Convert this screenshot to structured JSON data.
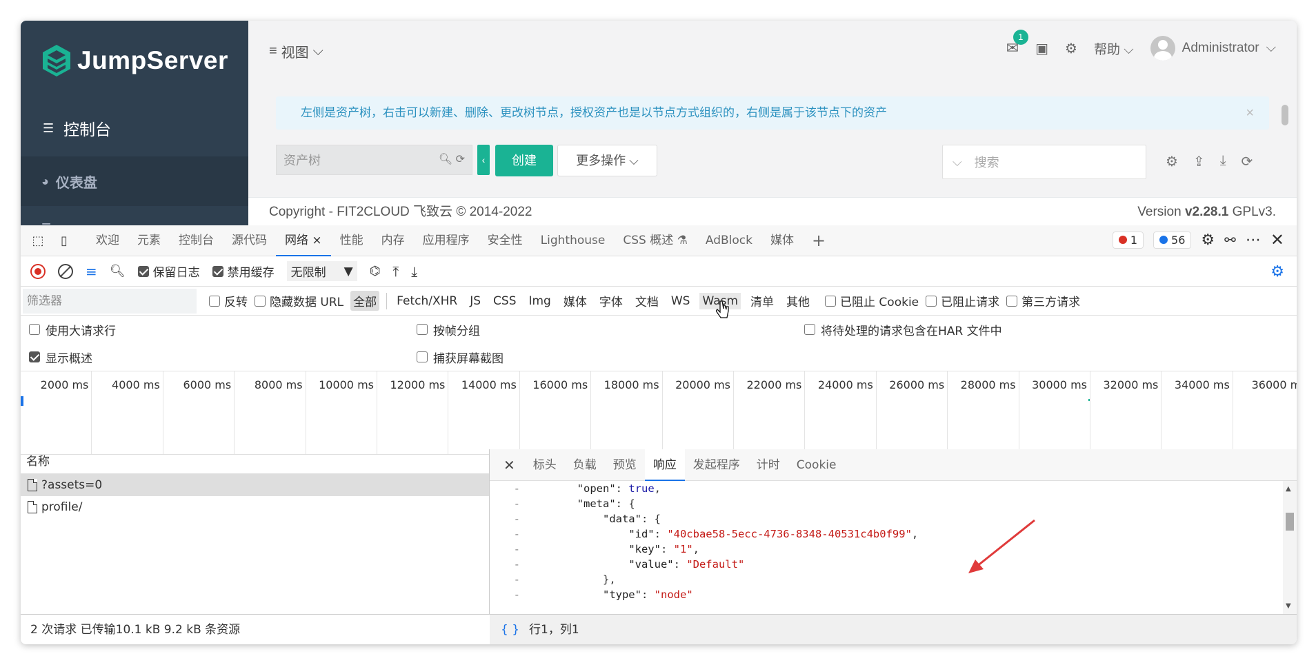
{
  "app": {
    "logo_text": "JumpServer",
    "console_label": "控制台",
    "dashboard_label": "仪表盘",
    "view_menu": "视图",
    "notification_count": "1",
    "help_label": "帮助",
    "user_name": "Administrator",
    "alert_text": "左侧是资产树，右击可以新建、删除、更改树节点，授权资产也是以节点方式组织的，右侧是属于该节点下的资产",
    "tree_placeholder": "资产树",
    "create_label": "创建",
    "more_actions_label": "更多操作",
    "search_placeholder": "搜索",
    "copyright": "Copyright - FIT2CLOUD 飞致云 © 2014-2022",
    "version_prefix": "Version ",
    "version_number": "v2.28.1",
    "version_suffix": " GPLv3.",
    "colors": {
      "sidebar": "#2f4050",
      "primary": "#1ab394",
      "alert_text": "#2b91bf"
    }
  },
  "devtools": {
    "tabs": [
      "欢迎",
      "元素",
      "控制台",
      "源代码",
      "网络",
      "性能",
      "内存",
      "应用程序",
      "安全性",
      "Lighthouse",
      "CSS 概述",
      "AdBlock",
      "媒体"
    ],
    "active_tab": "网络",
    "error_count": "1",
    "message_count": "56",
    "toolbar": {
      "preserve_log": "保留日志",
      "disable_cache": "禁用缓存",
      "throttle": "无限制"
    },
    "filter": {
      "placeholder": "筛选器",
      "invert": "反转",
      "hide_data_urls": "隐藏数据 URL",
      "types": [
        "全部",
        "Fetch/XHR",
        "JS",
        "CSS",
        "Img",
        "媒体",
        "字体",
        "文档",
        "WS",
        "Wasm",
        "清单",
        "其他"
      ],
      "blocked_cookies": "已阻止 Cookie",
      "blocked_requests": "已阻止请求",
      "third_party": "第三方请求"
    },
    "options": {
      "big_rows": "使用大请求行",
      "group_by_frame": "按帧分组",
      "include_pending_har": "将待处理的请求包含在HAR 文件中",
      "show_overview": "显示概述",
      "capture_screenshots": "捕获屏幕截图"
    },
    "timeline_labels": [
      "2000 ms",
      "4000 ms",
      "6000 ms",
      "8000 ms",
      "10000 ms",
      "12000 ms",
      "14000 ms",
      "16000 ms",
      "18000 ms",
      "20000 ms",
      "22000 ms",
      "24000 ms",
      "26000 ms",
      "28000 ms",
      "30000 ms",
      "32000 ms",
      "34000 ms",
      "36000 m"
    ],
    "requests_header": "名称",
    "requests": [
      "?assets=0",
      "profile/"
    ],
    "status_summary": "2 次请求  已传输10.1 kB  9.2 kB 条资源",
    "detail_tabs": [
      "标头",
      "负载",
      "预览",
      "响应",
      "发起程序",
      "计时",
      "Cookie"
    ],
    "detail_active": "响应",
    "code_lines": [
      {
        "indent": "        ",
        "key": "\"open\"",
        "sep": ": ",
        "val": "true",
        "vtype": "kw",
        "tail": ","
      },
      {
        "indent": "        ",
        "key": "\"meta\"",
        "sep": ": ",
        "val": "",
        "vtype": "",
        "tail": "{"
      },
      {
        "indent": "            ",
        "key": "\"data\"",
        "sep": ": ",
        "val": "",
        "vtype": "",
        "tail": "{"
      },
      {
        "indent": "                ",
        "key": "\"id\"",
        "sep": ": ",
        "val": "\"40cbae58-5ecc-4736-8348-40531c4b0f99\"",
        "vtype": "str",
        "tail": ","
      },
      {
        "indent": "                ",
        "key": "\"key\"",
        "sep": ": ",
        "val": "\"1\"",
        "vtype": "str",
        "tail": ","
      },
      {
        "indent": "                ",
        "key": "\"value\"",
        "sep": ": ",
        "val": "\"Default\"",
        "vtype": "str",
        "tail": ""
      },
      {
        "indent": "            ",
        "key": "",
        "sep": "",
        "val": "",
        "vtype": "",
        "tail": "},"
      },
      {
        "indent": "            ",
        "key": "\"type\"",
        "sep": ": ",
        "val": "\"node\"",
        "vtype": "str",
        "tail": ""
      }
    ],
    "gutter_mark": "-",
    "cursor_position": "行1，列1",
    "brace_icon": "{ }"
  }
}
